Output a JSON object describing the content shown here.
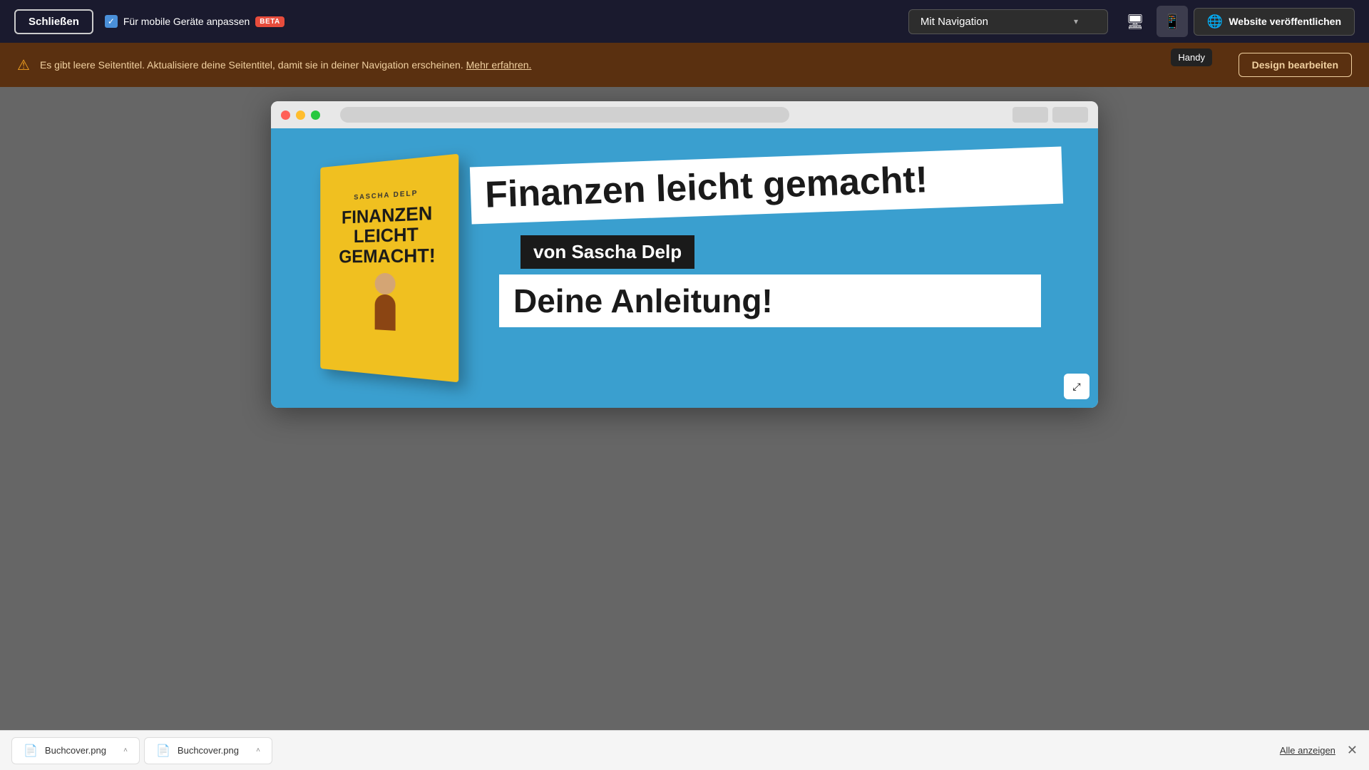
{
  "toolbar": {
    "close_label": "Schließen",
    "mobile_toggle_label": "Für mobile Geräte anpassen",
    "beta_badge": "BETA",
    "nav_dropdown_value": "Mit Navigation",
    "publish_label": "Website veröffentlichen",
    "tooltip_handy": "Handy"
  },
  "warning": {
    "text": "Es gibt leere Seitentitel. Aktualisiere deine Seitentitel, damit sie in deiner Navigation erscheinen.",
    "link_text": "Mehr erfahren.",
    "button_label": "Design bearbeiten"
  },
  "website": {
    "title_text": "Finanzen leicht gemacht!",
    "author_text": "von Sascha Delp",
    "subtitle_text": "Deine Anleitung!",
    "book_author": "SASCHA DELP",
    "book_title_line1": "FINANZEN",
    "book_title_line2": "LEICHT",
    "book_title_line3": "GEMACHT!"
  },
  "downloads": {
    "item1_name": "Buchcover.png",
    "item2_name": "Buchcover.png",
    "show_all_label": "Alle anzeigen"
  },
  "icons": {
    "desktop": "🖥",
    "mobile": "📱",
    "globe": "🌐",
    "warning": "⚠",
    "file": "📄",
    "expand": "⤢",
    "close": "✕",
    "chevron_down": "▾",
    "chevron_up": "˄",
    "check": "✓"
  }
}
